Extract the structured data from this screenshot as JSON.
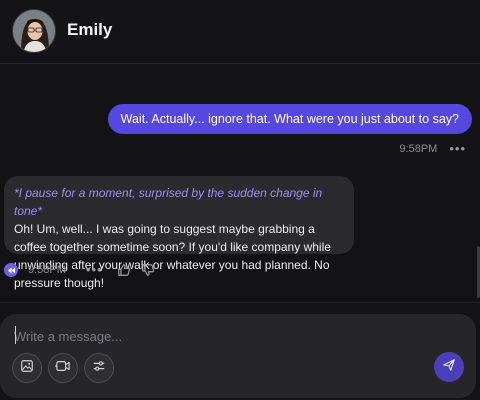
{
  "header": {
    "contact_name": "Emily",
    "avatar_icon": "user-avatar-photo"
  },
  "conversation": {
    "user_message": {
      "text": "Wait. Actually... ignore that. What were you just about to say?",
      "time": "9:58PM",
      "more_glyph": "•••"
    },
    "bot_message": {
      "action": "*I pause for a moment, surprised by the sudden change in tone*",
      "text": "Oh! Um, well... I was going to suggest maybe grabbing a coffee together sometime soon? If you'd like company while unwinding after your walk or whatever you had planned. No pressure though!",
      "time": "9:58PM",
      "more_glyph": "•••",
      "icons": [
        "audio-play-icon",
        "thumbs-up-icon",
        "thumbs-down-icon"
      ]
    }
  },
  "composer": {
    "placeholder": "Write a message...",
    "value": "",
    "tool_icons": [
      "image-generate-icon",
      "video-camera-icon",
      "sliders-settings-icon"
    ],
    "send_icon": "send-icon"
  },
  "colors": {
    "background": "#131316",
    "user_bubble": "#5547e0",
    "bot_bubble": "#2a2a2f",
    "action_text": "#9f8ff5",
    "send_button": "#4b3fba"
  }
}
